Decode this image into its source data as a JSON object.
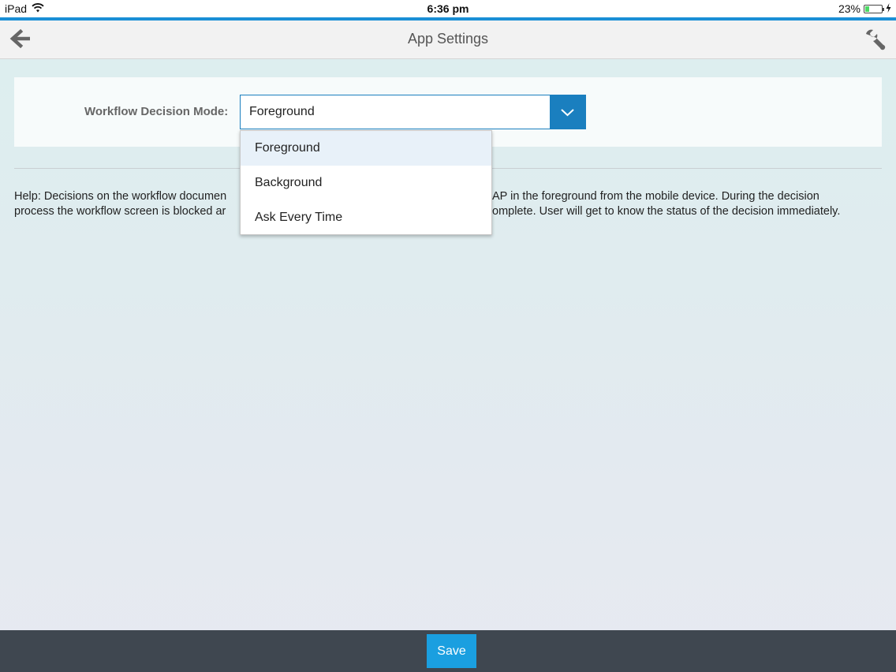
{
  "status_bar": {
    "device": "iPad",
    "time": "6:36 pm",
    "battery_percent": "23%",
    "battery_level": 0.23,
    "icons": [
      "wifi-icon",
      "battery-icon",
      "charging-bolt-icon"
    ]
  },
  "colors": {
    "accent": "#1a8fd6",
    "select_blue": "#1a7fbf",
    "save_button": "#1a9fe0",
    "footer": "#3f4750"
  },
  "navbar": {
    "title": "App Settings",
    "back_icon": "back-arrow-icon",
    "settings_icon": "wrench-icon"
  },
  "settings": {
    "workflow_mode_label": "Workflow Decision Mode:",
    "workflow_mode_value": "Foreground",
    "dropdown_icon": "chevron-down-icon"
  },
  "help": {
    "text": "Help: Decisions on the workflow documents are processed synchronously with SAP in the foreground from the mobile device. During the decision process the workflow screen is blocked and the user must wait until the process is complete. User will get to know the status of the decision immediately.",
    "visible_line1_start": "Help: Decisions on the workflow documen",
    "visible_line1_end": "AP in the foreground from the mobile device. During the decision",
    "visible_line2_start": "process the workflow screen is blocked ar",
    "visible_line2_end": "omplete. User will get to know the status of the decision immediately."
  },
  "dropdown": {
    "options": [
      {
        "label": "Foreground",
        "selected": true
      },
      {
        "label": "Background",
        "selected": false
      },
      {
        "label": "Ask Every Time",
        "selected": false
      }
    ]
  },
  "footer": {
    "save_label": "Save"
  }
}
